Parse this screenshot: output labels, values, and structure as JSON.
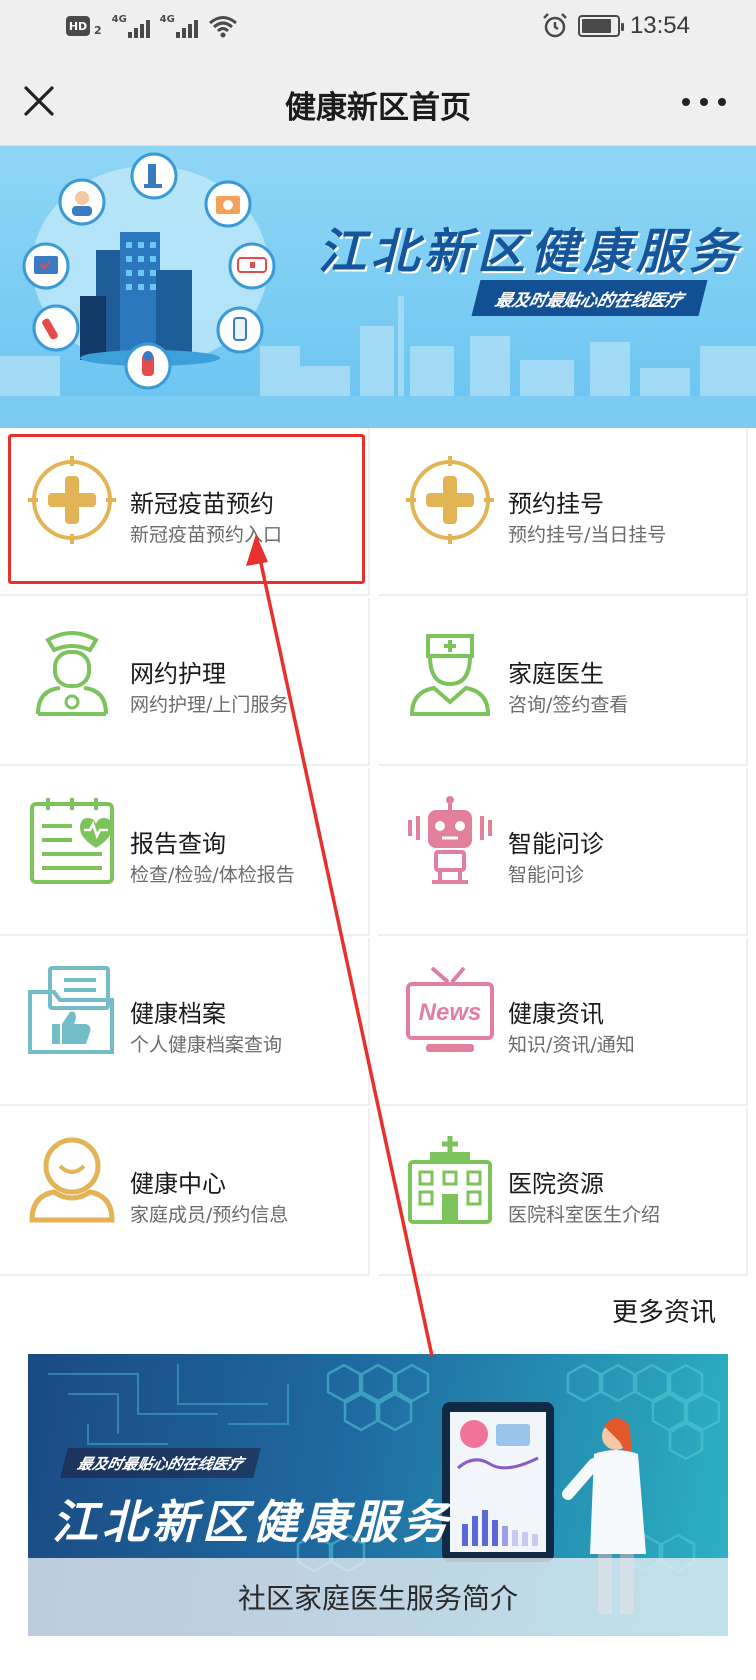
{
  "status_bar": {
    "hd_label": "HD",
    "sim_label": "2",
    "signal1_label": "4G",
    "signal2_label": "4G",
    "time": "13:54",
    "battery_level": 0.85
  },
  "header": {
    "title": "健康新区首页"
  },
  "banner": {
    "title": "江北新区健康服务",
    "subtitle": "最及时最贴心的在线医疗"
  },
  "services": [
    {
      "title": "新冠疫苗预约",
      "subtitle": "新冠疫苗预约入口",
      "icon": "plus-crosshair-icon"
    },
    {
      "title": "预约挂号",
      "subtitle": "预约挂号/当日挂号",
      "icon": "plus-crosshair-icon"
    },
    {
      "title": "网约护理",
      "subtitle": "网约护理/上门服务",
      "icon": "nurse-icon"
    },
    {
      "title": "家庭医生",
      "subtitle": "咨询/签约查看",
      "icon": "doctor-icon"
    },
    {
      "title": "报告查询",
      "subtitle": "检查/检验/体检报告",
      "icon": "report-icon"
    },
    {
      "title": "智能问诊",
      "subtitle": "智能问诊",
      "icon": "robot-icon"
    },
    {
      "title": "健康档案",
      "subtitle": "个人健康档案查询",
      "icon": "folder-thumb-icon"
    },
    {
      "title": "健康资讯",
      "subtitle": "知识/资讯/通知",
      "icon": "news-tv-icon"
    },
    {
      "title": "健康中心",
      "subtitle": "家庭成员/预约信息",
      "icon": "user-icon"
    },
    {
      "title": "医院资源",
      "subtitle": "医院科室医生介绍",
      "icon": "hospital-icon"
    }
  ],
  "more_news": "更多资讯",
  "bottom_banner": {
    "subtitle": "最及时最贴心的在线医疗",
    "title": "江北新区健康服务",
    "caption": "社区家庭医生服务简介",
    "tv_word": "News"
  },
  "colors": {
    "gold": "#e2b455",
    "green": "#7cc35b",
    "pink": "#e17f9d",
    "teal": "#72bdc8",
    "highlight_red": "#e8302c",
    "arrow_red": "#e8302c"
  }
}
